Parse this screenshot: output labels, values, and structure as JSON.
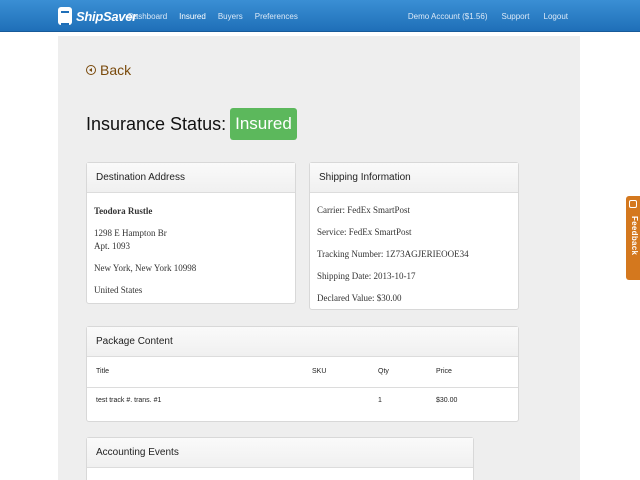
{
  "nav": {
    "brand": "ShipSaver",
    "items": [
      "Dashboard",
      "Insured",
      "Buyers",
      "Preferences"
    ],
    "active": "Insured",
    "right": [
      "Demo Account ($1.56)",
      "Support",
      "Logout"
    ]
  },
  "back_label": "Back",
  "status": {
    "label": "Insurance Status:",
    "badge": "Insured",
    "badge_color": "#5cb85c"
  },
  "destination": {
    "title": "Destination Address",
    "name": "Teodora Rustle",
    "street": "1298 E Hampton Br",
    "apt": "Apt. 1093",
    "city": "New York, New York 10998",
    "country": "United States"
  },
  "shipping": {
    "title": "Shipping Information",
    "carrier": "Carrier: FedEx SmartPost",
    "service": "Service: FedEx SmartPost",
    "tracking": "Tracking Number: 1Z73AGJERIEOOE34",
    "date": "Shipping Date: 2013-10-17",
    "declared": "Declared Value: $30.00"
  },
  "package": {
    "title": "Package Content",
    "columns": [
      "Title",
      "SKU",
      "Qty",
      "Price"
    ],
    "rows": [
      {
        "title": "test track #. trans. #1",
        "sku": "",
        "qty": "1",
        "price": "$30.00"
      }
    ]
  },
  "accounting": {
    "title": "Accounting Events"
  },
  "feedback_label": "Feedback"
}
